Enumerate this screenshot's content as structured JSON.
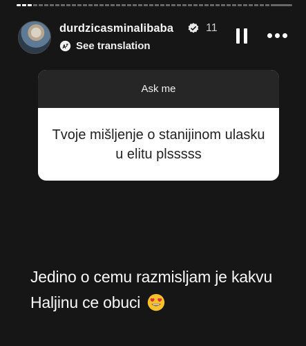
{
  "story": {
    "progress_fraction": 0.06
  },
  "header": {
    "username": "durdzicasminalibaba",
    "time": "11",
    "translate_label": "See translation",
    "verified_icon": "verified-badge-icon",
    "pause_icon": "pause-icon",
    "more_icon": "more-options-icon"
  },
  "question_card": {
    "title": "Ask me",
    "question": "Tvoje mišljenje o stanijinom ulasku u elitu plsssss"
  },
  "answer": {
    "line1": "Jedino o cemu razmisljam je kakvu",
    "line2": "Haljinu ce obuci",
    "emoji": "heart-eyes-emoji-icon"
  },
  "colors": {
    "background": "#161616",
    "card_header": "#262626",
    "card_body": "#ffffff",
    "text": "#ffffff"
  }
}
